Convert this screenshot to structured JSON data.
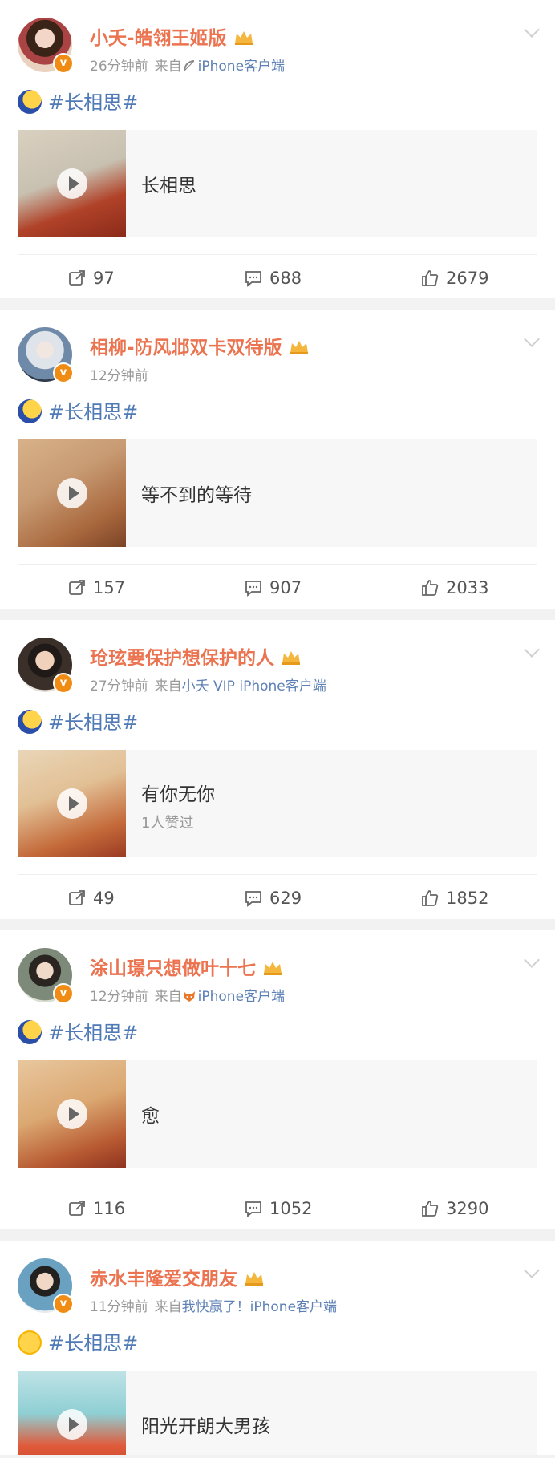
{
  "posts": [
    {
      "name": "小夭-皓翎王姬版",
      "time": "26分钟前",
      "from": "来自",
      "source": "iPhone客户端",
      "topic": "#长相思#",
      "media_title": "长相思",
      "media_sub": "",
      "shares": "97",
      "comments": "688",
      "likes": "2679"
    },
    {
      "name": "相柳-防风邶双卡双待版",
      "time": "12分钟前",
      "from": "",
      "source": "",
      "topic": "#长相思#",
      "media_title": "等不到的等待",
      "media_sub": "",
      "shares": "157",
      "comments": "907",
      "likes": "2033"
    },
    {
      "name": "玱玹要保护想保护的人",
      "time": "27分钟前",
      "from": "来自",
      "source": "小夭 VIP iPhone客户端",
      "topic": "#长相思#",
      "media_title": "有你无你",
      "media_sub": "1人赞过",
      "shares": "49",
      "comments": "629",
      "likes": "1852"
    },
    {
      "name": "涂山璟只想做叶十七",
      "time": "12分钟前",
      "from": "来自",
      "source": "iPhone客户端",
      "topic": "#长相思#",
      "media_title": "愈",
      "media_sub": "",
      "shares": "116",
      "comments": "1052",
      "likes": "3290"
    },
    {
      "name": "赤水丰隆爱交朋友",
      "time": "11分钟前",
      "from": "来自",
      "source": "我快赢了！iPhone客户端",
      "topic": "#长相思#",
      "media_title": "阳光开朗大男孩",
      "media_sub": ""
    }
  ],
  "icons": {
    "share": "share-icon",
    "comment": "comment-icon",
    "like": "thumbs-up-icon",
    "chevron": "chevron-down-icon",
    "play": "play-icon",
    "verified": "verified-badge-icon",
    "crown": "crown-icon"
  },
  "colors": {
    "username": "#eb7350",
    "topic": "#4f7ab6",
    "source": "#5d80b5",
    "meta": "#999999",
    "verified": "#f08c14"
  }
}
